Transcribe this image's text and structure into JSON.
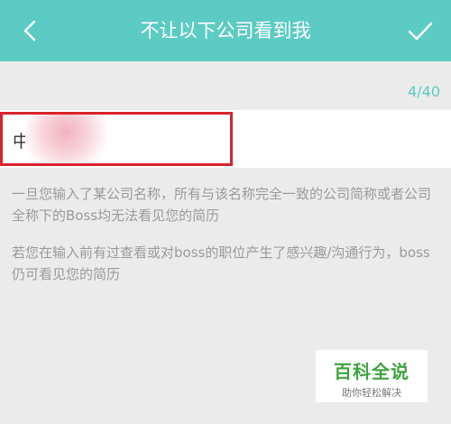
{
  "header": {
    "title": "不让以下公司看到我",
    "back_icon": "chevron-left-icon",
    "confirm_icon": "check-icon"
  },
  "counter": "4/40",
  "company_input": {
    "value": "中"
  },
  "description": {
    "paragraph1": "一旦您输入了某公司名称，所有与该名称完全一致的公司简称或者公司全称下的Boss均无法看见您的简历",
    "paragraph2": "若您在输入前有过查看或对boss的职位产生了感兴趣/沟通行为，boss仍可看见您的简历"
  },
  "watermark": {
    "main": "百科全说",
    "sub": "助你轻松解决"
  },
  "colors": {
    "accent": "#5ccbc3",
    "highlight": "#d8232a",
    "watermark_green": "#3fa33f"
  }
}
